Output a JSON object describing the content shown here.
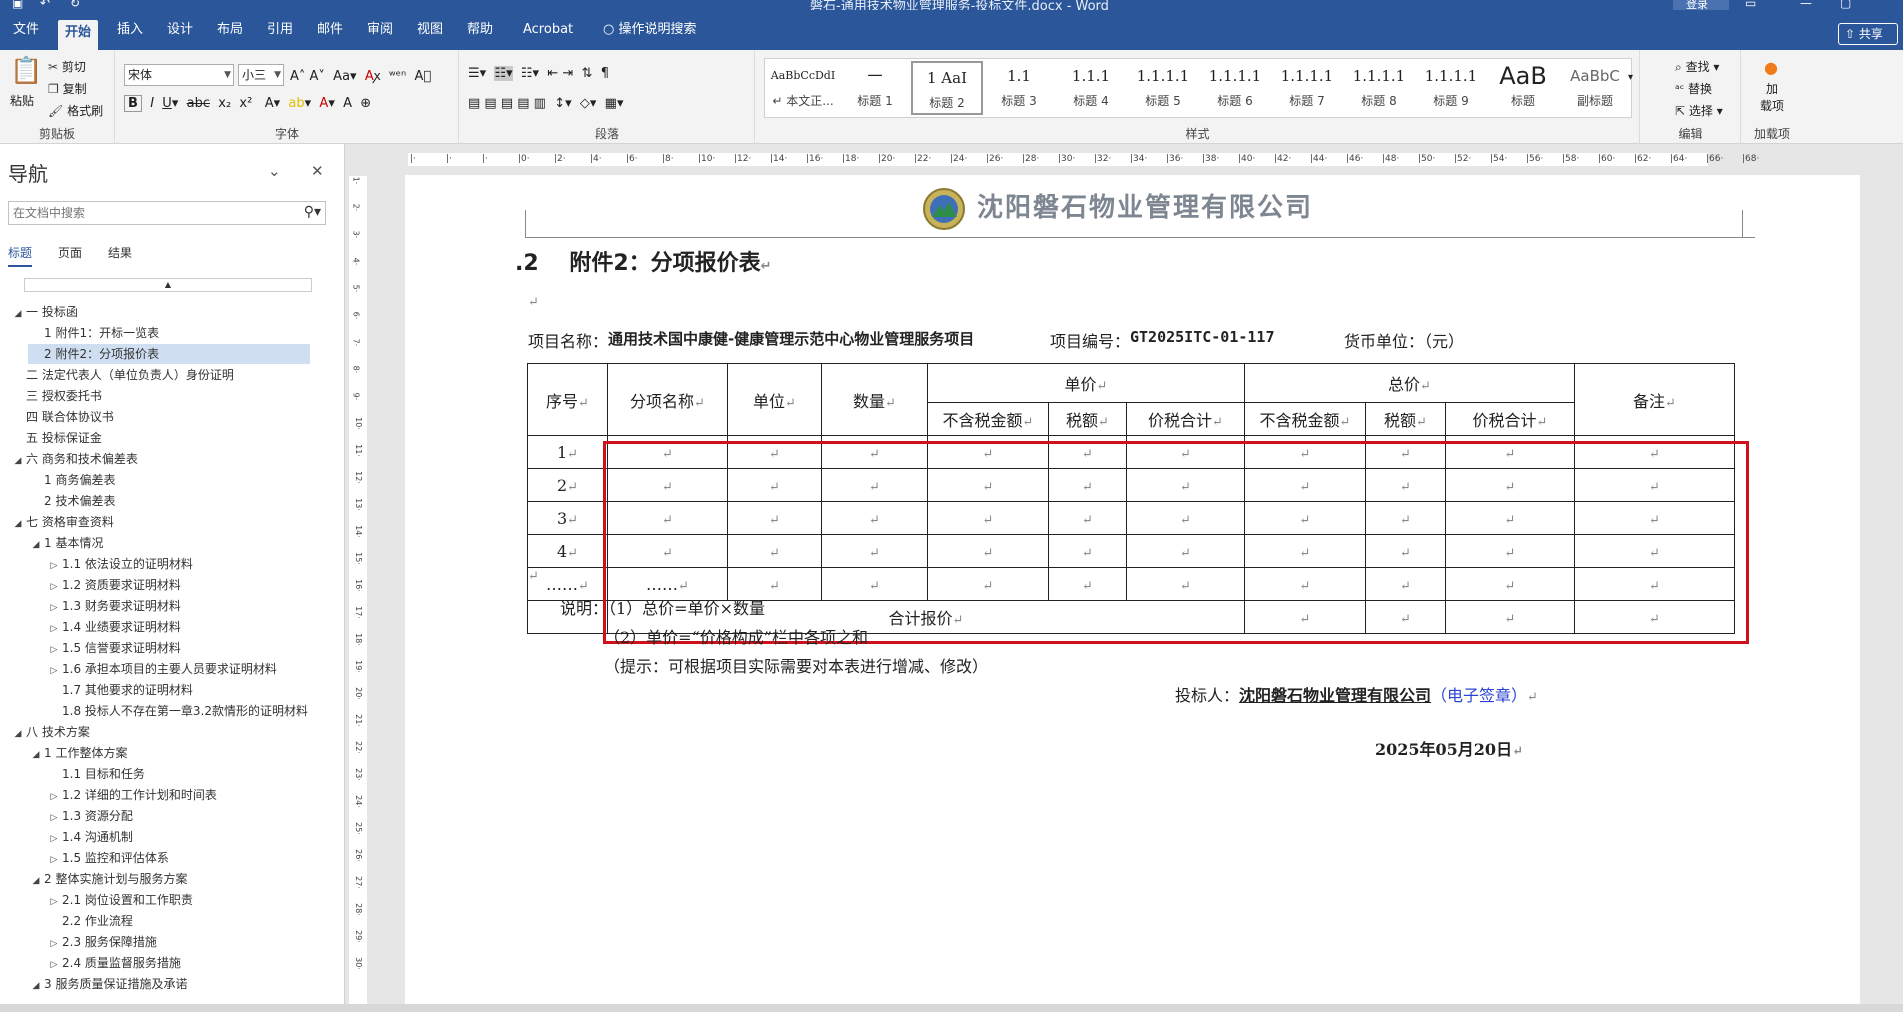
{
  "window": {
    "doc_title": "磐石-通用技术物业管理服务-投标文件.docx  -  Word",
    "login": "登录",
    "share": "共享"
  },
  "tabs": [
    "文件",
    "开始",
    "插入",
    "设计",
    "布局",
    "引用",
    "邮件",
    "审阅",
    "视图",
    "帮助",
    "Acrobat",
    "操作说明搜索"
  ],
  "active_tab": "开始",
  "ribbon": {
    "clipboard": {
      "paste": "粘贴",
      "cut": "剪切",
      "copy": "复制",
      "format_painter": "格式刷",
      "label": "剪贴板"
    },
    "font": {
      "name": "宋体",
      "size": "小三",
      "label": "字体"
    },
    "paragraph": {
      "label": "段落"
    },
    "styles": {
      "label": "样式",
      "items": [
        {
          "preview": "AaBbCcDdI",
          "name": "↵ 本文正..."
        },
        {
          "preview": "一",
          "name": "标题 1"
        },
        {
          "preview": "1 AaI",
          "name": "标题 2"
        },
        {
          "preview": "1.1",
          "name": "标题 3"
        },
        {
          "preview": "1.1.1",
          "name": "标题 4"
        },
        {
          "preview": "1.1.1.1",
          "name": "标题 5"
        },
        {
          "preview": "1.1.1.1",
          "name": "标题 6"
        },
        {
          "preview": "1.1.1.1",
          "name": "标题 7"
        },
        {
          "preview": "1.1.1.1",
          "name": "标题 8"
        },
        {
          "preview": "1.1.1.1",
          "name": "标题 9"
        },
        {
          "preview": "AaB",
          "name": "标题"
        },
        {
          "preview": "AaBbC",
          "name": "副标题"
        }
      ]
    },
    "editing": {
      "find": "查找",
      "replace": "替换",
      "select": "选择",
      "label": "编辑"
    },
    "addins": {
      "load": "加\n载项",
      "label": "加载项"
    }
  },
  "nav": {
    "title": "导航",
    "search_placeholder": "在文档中搜索",
    "tabs": [
      "标题",
      "页面",
      "结果"
    ],
    "items": [
      {
        "text": "一 投标函",
        "level": 0,
        "exp": "◢"
      },
      {
        "text": "1 附件1：开标一览表",
        "level": 1,
        "exp": ""
      },
      {
        "text": "2 附件2：分项报价表",
        "level": 1,
        "exp": "",
        "active": true
      },
      {
        "text": "二 法定代表人（单位负责人）身份证明",
        "level": 0,
        "exp": ""
      },
      {
        "text": "三 授权委托书",
        "level": 0,
        "exp": ""
      },
      {
        "text": "四 联合体协议书",
        "level": 0,
        "exp": ""
      },
      {
        "text": "五 投标保证金",
        "level": 0,
        "exp": ""
      },
      {
        "text": "六 商务和技术偏差表",
        "level": 0,
        "exp": "◢"
      },
      {
        "text": "1 商务偏差表",
        "level": 1,
        "exp": ""
      },
      {
        "text": "2 技术偏差表",
        "level": 1,
        "exp": ""
      },
      {
        "text": "七 资格审查资料",
        "level": 0,
        "exp": "◢"
      },
      {
        "text": "1 基本情况",
        "level": 1,
        "exp": "◢"
      },
      {
        "text": "1.1 依法设立的证明材料",
        "level": 2,
        "exp": "▷"
      },
      {
        "text": "1.2 资质要求证明材料",
        "level": 2,
        "exp": "▷"
      },
      {
        "text": "1.3 财务要求证明材料",
        "level": 2,
        "exp": "▷"
      },
      {
        "text": "1.4 业绩要求证明材料",
        "level": 2,
        "exp": "▷"
      },
      {
        "text": "1.5 信誉要求证明材料",
        "level": 2,
        "exp": "▷"
      },
      {
        "text": "1.6 承担本项目的主要人员要求证明材料",
        "level": 2,
        "exp": "▷"
      },
      {
        "text": "1.7 其他要求的证明材料",
        "level": 2,
        "exp": ""
      },
      {
        "text": "1.8 投标人不存在第一章3.2款情形的证明材料",
        "level": 2,
        "exp": ""
      },
      {
        "text": "八 技术方案",
        "level": 0,
        "exp": "◢"
      },
      {
        "text": "1 工作整体方案",
        "level": 1,
        "exp": "◢"
      },
      {
        "text": "1.1 目标和任务",
        "level": 2,
        "exp": ""
      },
      {
        "text": "1.2 详细的工作计划和时间表",
        "level": 2,
        "exp": "▷"
      },
      {
        "text": "1.3 资源分配",
        "level": 2,
        "exp": "▷"
      },
      {
        "text": "1.4 沟通机制",
        "level": 2,
        "exp": "▷"
      },
      {
        "text": "1.5 监控和评估体系",
        "level": 2,
        "exp": "▷"
      },
      {
        "text": "2 整体实施计划与服务方案",
        "level": 1,
        "exp": "◢"
      },
      {
        "text": "2.1 岗位设置和工作职责",
        "level": 2,
        "exp": "▷"
      },
      {
        "text": "2.2 作业流程",
        "level": 2,
        "exp": ""
      },
      {
        "text": "2.3 服务保障措施",
        "level": 2,
        "exp": "▷"
      },
      {
        "text": "2.4 质量监督服务措施",
        "level": 2,
        "exp": "▷"
      },
      {
        "text": "3 服务质量保证措施及承诺",
        "level": 1,
        "exp": "◢"
      }
    ]
  },
  "document": {
    "letterhead": "沈阳磐石物业管理有限公司",
    "heading_num": ".2",
    "heading": "附件2：分项报价表",
    "project_name_label": "项目名称：",
    "project_name": "通用技术国中康健-健康管理示范中心物业管理服务项目",
    "project_no_label": "项目编号：",
    "project_no": "GT2025ITC-01-117",
    "currency": "货币单位：（元）",
    "table": {
      "h_seq": "序号",
      "h_item": "分项名称",
      "h_unit": "单位",
      "h_qty": "数量",
      "h_unitprice": "单价",
      "h_total": "总价",
      "h_remark": "备注",
      "h_sub": [
        "不含税金额",
        "税额",
        "价税合计",
        "不含税金额",
        "税额",
        "价税合计"
      ],
      "rows": [
        "1",
        "2",
        "3",
        "4",
        "……"
      ],
      "row5_item": "……",
      "total_label": "合计报价"
    },
    "notes": [
      "说明：（1）总价=单价×数量",
      "（2）单价=“价格构成”栏中各项之和",
      "（提示：可根据项目实际需要对本表进行增减、修改）"
    ],
    "bidder_label": "投标人：",
    "bidder": "沈阳磐石物业管理有限公司",
    "esign": "（电子签章）",
    "date": "2025年05月20日",
    "pm": "↵"
  },
  "colors": {
    "accent": "#2b579a",
    "highlight_box": "#d0101b"
  }
}
